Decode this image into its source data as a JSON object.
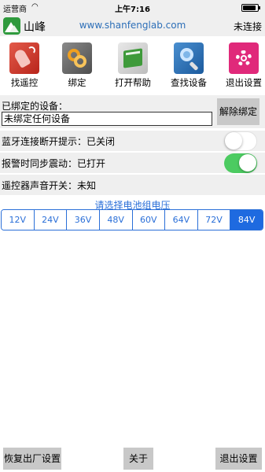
{
  "status_bar": {
    "carrier": "运营商",
    "time": "上午7:16",
    "battery_level": 0.9
  },
  "header": {
    "app_name": "山峰",
    "url": "www.shanfenglab.com",
    "connection_status": "未连接"
  },
  "toolbar": {
    "items": [
      {
        "label": "找遥控",
        "icon": "remote-key-icon"
      },
      {
        "label": "绑定",
        "icon": "link-rings-icon"
      },
      {
        "label": "打开帮助",
        "icon": "help-book-icon"
      },
      {
        "label": "查找设备",
        "icon": "magnifier-icon"
      },
      {
        "label": "退出设置",
        "icon": "gear-icon"
      }
    ]
  },
  "bound_device": {
    "label": "已绑定的设备：",
    "value": "未绑定任何设备",
    "unbind_label": "解除绑定"
  },
  "settings": {
    "bluetooth_disconnect": {
      "label": "蓝牙连接断开提示：已关闭",
      "on": false
    },
    "alarm_vibrate": {
      "label": "报警时同步震动：已打开",
      "on": true
    },
    "remote_sound": {
      "label": "遥控器声音开关：未知"
    }
  },
  "voltage": {
    "title": "请选择电池组电压",
    "options": [
      "12V",
      "24V",
      "36V",
      "48V",
      "60V",
      "64V",
      "72V",
      "84V"
    ],
    "selected": "84V"
  },
  "bottom_bar": {
    "factory_reset_label": "恢复出厂设置",
    "about_label": "关于",
    "exit_label": "退出设置"
  },
  "colors": {
    "accent": "#2a6fd8",
    "toggle_on": "#4ccb61",
    "panel_bg": "#efefef",
    "button_bg": "#c8c8c8"
  }
}
